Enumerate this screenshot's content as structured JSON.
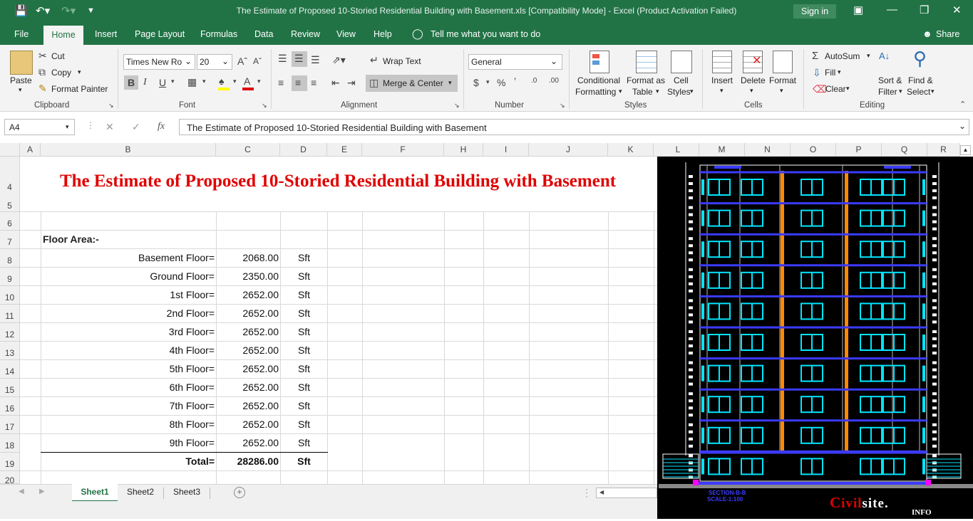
{
  "window": {
    "title": "The Estimate of Proposed 10-Storied Residential Building with Basement.xls  [Compatibility Mode]  -  Excel (Product Activation Failed)",
    "sign_in": "Sign in"
  },
  "tabs": [
    "File",
    "Home",
    "Insert",
    "Page Layout",
    "Formulas",
    "Data",
    "Review",
    "View",
    "Help"
  ],
  "tell_me": "Tell me what you want to do",
  "share": "Share",
  "ribbon": {
    "clipboard": {
      "paste": "Paste",
      "cut": "Cut",
      "copy": "Copy",
      "format_painter": "Format Painter",
      "group": "Clipboard"
    },
    "font": {
      "name": "Times New Ro",
      "size": "20",
      "group": "Font"
    },
    "alignment": {
      "wrap": "Wrap Text",
      "merge": "Merge & Center",
      "group": "Alignment"
    },
    "number": {
      "format": "General",
      "group": "Number"
    },
    "styles": {
      "conditional": "Conditional",
      "formatting": "Formatting",
      "format_as": "Format as",
      "table": "Table",
      "cell": "Cell",
      "styles_lbl": "Styles",
      "group": "Styles"
    },
    "cells": {
      "insert": "Insert",
      "delete": "Delete",
      "format": "Format",
      "group": "Cells"
    },
    "editing": {
      "autosum": "AutoSum",
      "fill": "Fill",
      "clear": "Clear",
      "sort": "Sort &",
      "filter": "Filter",
      "find": "Find &",
      "select": "Select",
      "group": "Editing"
    }
  },
  "formula_bar": {
    "name_box": "A4",
    "fx": "fx",
    "content": "The Estimate of Proposed 10-Storied Residential Building with Basement"
  },
  "columns": [
    "A",
    "B",
    "C",
    "D",
    "E",
    "F",
    "H",
    "I",
    "J",
    "K"
  ],
  "right_columns": [
    "L",
    "M",
    "N",
    "O",
    "P",
    "Q",
    "R"
  ],
  "rows": [
    "4",
    "5",
    "6",
    "7",
    "8",
    "9",
    "10",
    "11",
    "12",
    "13",
    "14",
    "15",
    "16",
    "17",
    "18",
    "19",
    "20"
  ],
  "sheet": {
    "title": "The Estimate of Proposed 10-Storied Residential Building with Basement",
    "heading": "Floor Area:-",
    "floors": [
      {
        "label": "Basement Floor=",
        "value": "2068.00",
        "unit": "Sft"
      },
      {
        "label": "Ground Floor=",
        "value": "2350.00",
        "unit": "Sft"
      },
      {
        "label": "1st Floor=",
        "value": "2652.00",
        "unit": "Sft"
      },
      {
        "label": "2nd Floor=",
        "value": "2652.00",
        "unit": "Sft"
      },
      {
        "label": "3rd Floor=",
        "value": "2652.00",
        "unit": "Sft"
      },
      {
        "label": "4th Floor=",
        "value": "2652.00",
        "unit": "Sft"
      },
      {
        "label": "5th Floor=",
        "value": "2652.00",
        "unit": "Sft"
      },
      {
        "label": "6th Floor=",
        "value": "2652.00",
        "unit": "Sft"
      },
      {
        "label": "7th Floor=",
        "value": "2652.00",
        "unit": "Sft"
      },
      {
        "label": "8th Floor=",
        "value": "2652.00",
        "unit": "Sft"
      },
      {
        "label": "9th Floor=",
        "value": "2652.00",
        "unit": "Sft"
      }
    ],
    "total": {
      "label": "Total=",
      "value": "28286.00",
      "unit": "Sft"
    }
  },
  "sheet_tabs": [
    "Sheet1",
    "Sheet2",
    "Sheet3"
  ],
  "drawing": {
    "section": "SECTION-B-B",
    "scale": "SCALE-1:100",
    "brand": "Civilsite",
    "brand_suffix": "INFO"
  },
  "colors": {
    "accent": "#217346",
    "title_red": "#e00000",
    "cad_bg": "#000000",
    "cad_blue": "#3b3bff",
    "cad_cyan": "#00e5ff",
    "cad_orange": "#ff8a00"
  }
}
